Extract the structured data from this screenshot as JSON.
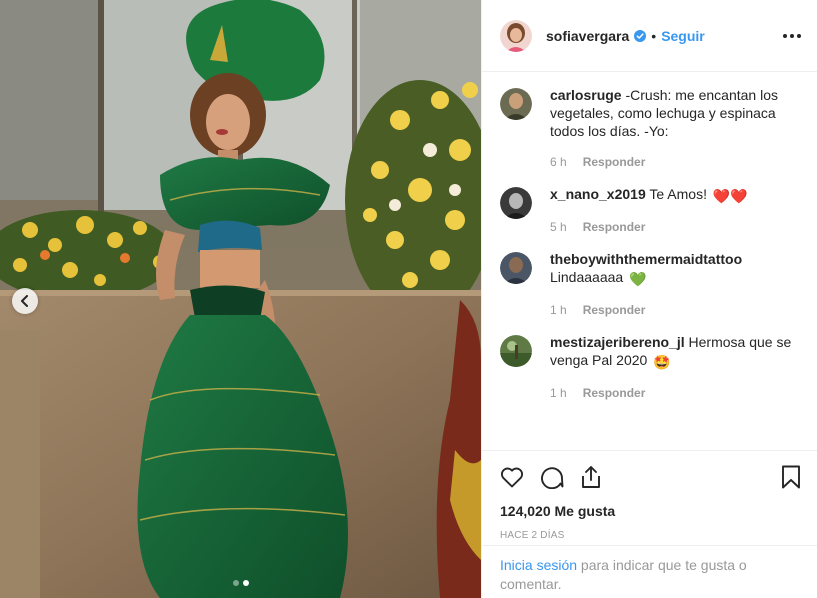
{
  "post": {
    "username": "sofiavergara",
    "verified": true,
    "follow_label": "Seguir",
    "separator": "•",
    "more_icon": "more-options-icon"
  },
  "carousel": {
    "prev_icon": "chevron-left-icon",
    "dots": [
      false,
      true
    ]
  },
  "comments": [
    {
      "user": "carlosruge",
      "text": "-Crush: me encantan los vegetales, como lechuga y espinaca todos los días. -Yo:",
      "time": "6 h",
      "reply": "Responder",
      "avatar_color": "#4a4a3a"
    },
    {
      "user": "x_nano_x2019",
      "text": "Te Amos!",
      "emoji": "❤️❤️",
      "time": "5 h",
      "reply": "Responder",
      "avatar_color": "#2a2a2a"
    },
    {
      "user": "theboywiththemermaidtattoo",
      "text": "Lindaaaaaa",
      "emoji": "💚",
      "time": "1 h",
      "reply": "Responder",
      "avatar_color": "#3d4a5a"
    },
    {
      "user": "mestizajeribereno_jl",
      "text": "Hermosa que se venga Pal 2020",
      "emoji": "🤩",
      "time": "1 h",
      "reply": "Responder",
      "avatar_color": "#4f6b3a"
    }
  ],
  "actions": {
    "like_icon": "heart-icon",
    "comment_icon": "comment-icon",
    "share_icon": "share-icon",
    "save_icon": "bookmark-icon"
  },
  "likes": "124,020 Me gusta",
  "posted": "HACE 2 DÍAS",
  "login": {
    "link": "Inicia sesión",
    "rest": " para indicar que te gusta o comentar."
  },
  "colors": {
    "link": "#3897f0",
    "muted": "#999999",
    "text": "#262626",
    "heart_red": "#ed1c3a",
    "heart_green": "#2bb52b"
  }
}
